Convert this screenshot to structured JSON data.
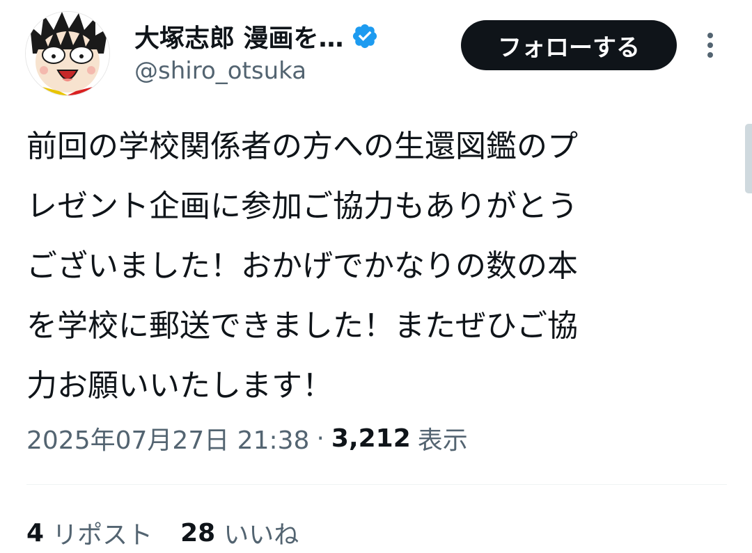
{
  "author": {
    "display_name": "大塚志郎 漫画を…",
    "handle": "@shiro_otsuka",
    "verified": true
  },
  "actions": {
    "follow_label": "フォローする"
  },
  "tweet": {
    "text_lines": [
      "前回の学校関係者の方への生還図鑑のプ",
      "レゼント企画に参加ご協力もありがとう",
      "ございました！おかげでかなりの数の本",
      "を学校に郵送できました！またぜひご協",
      "力お願いいたします！"
    ],
    "timestamp": "2025年07月27日 21:38",
    "separator": "·",
    "views_count": "3,212",
    "views_label": "表示"
  },
  "stats": {
    "reposts_count": "4",
    "reposts_label": "リポスト",
    "likes_count": "28",
    "likes_label": "いいね"
  },
  "colors": {
    "text_primary": "#0f1419",
    "text_secondary": "#536471",
    "verified_blue": "#1d9bf0",
    "button_bg": "#0f1419",
    "divider": "#eff3f4"
  },
  "icons": {
    "verified": "verified-badge-icon",
    "more": "more-vertical-icon"
  }
}
